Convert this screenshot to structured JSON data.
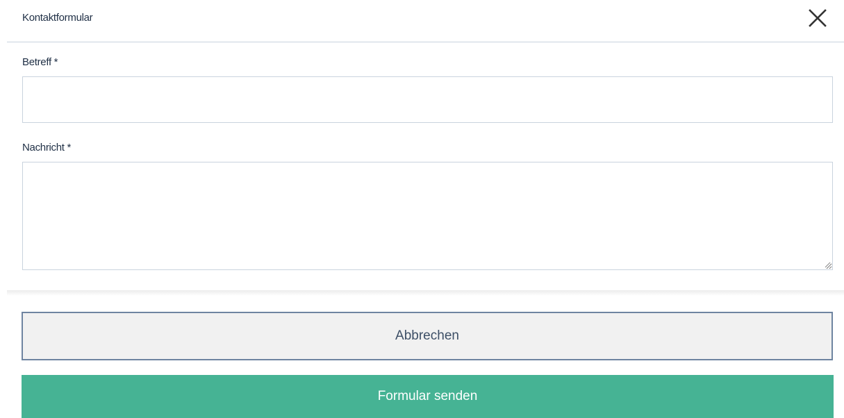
{
  "dialog": {
    "title": "Kontaktformular",
    "close_icon": "close-icon"
  },
  "form": {
    "subject_label": "Betreff *",
    "subject_value": "",
    "message_label": "Nachricht *",
    "message_value": ""
  },
  "actions": {
    "cancel_label": "Abbrechen",
    "submit_label": "Formular senden"
  },
  "colors": {
    "primary_text": "#1f2f45",
    "border": "#c9d3de",
    "cancel_border": "#6e84a0",
    "cancel_background": "#f1f1f1",
    "submit_background": "#46b394"
  }
}
